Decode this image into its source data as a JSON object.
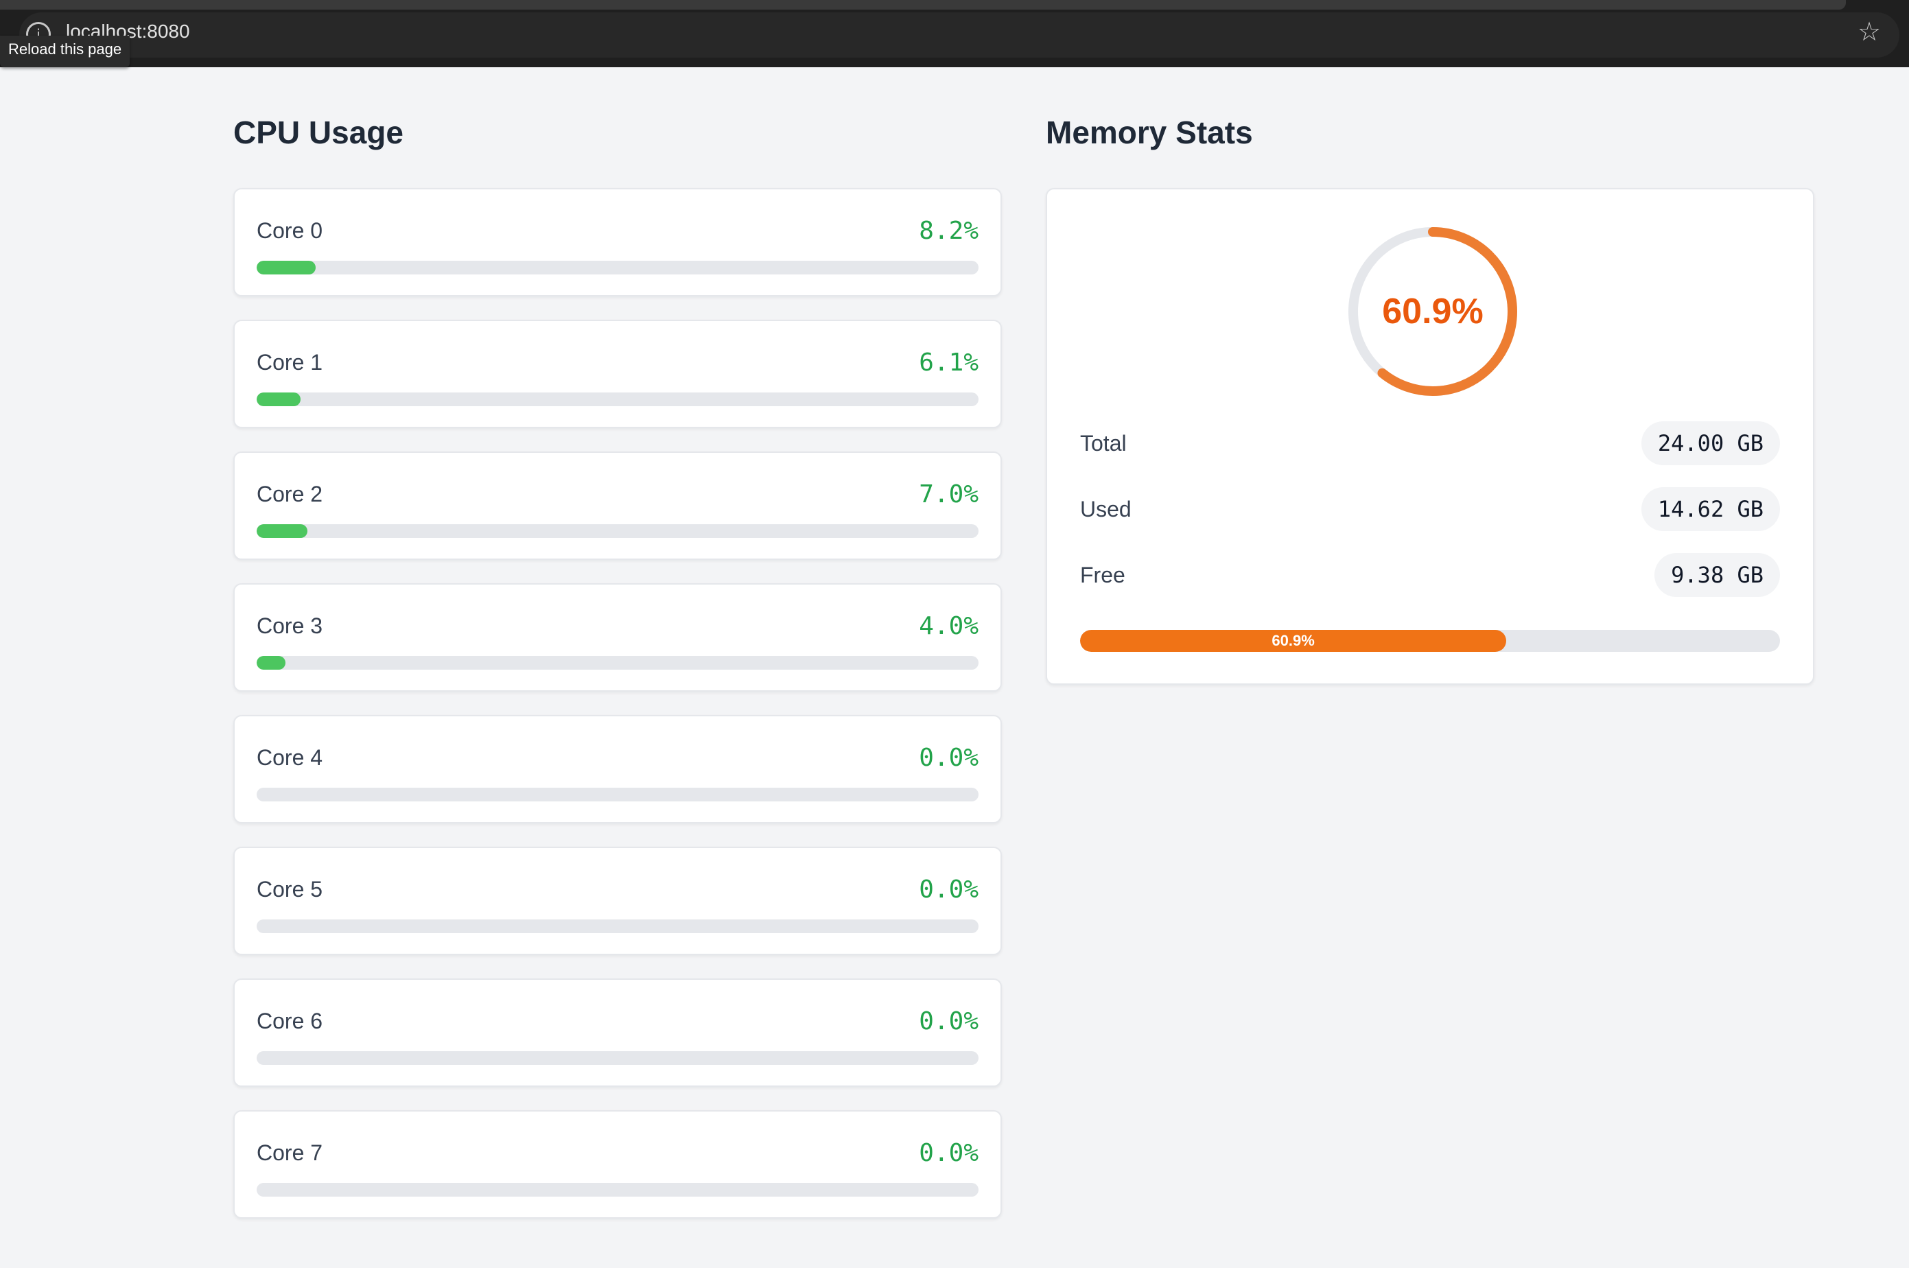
{
  "browser": {
    "url": "localhost:8080",
    "tooltip": "Reload this page",
    "info_icon": "info-icon",
    "star_icon": "bookmark-star-icon"
  },
  "cpu": {
    "title": "CPU Usage",
    "cores": [
      {
        "label": "Core 0",
        "value_text": "8.2%",
        "percent": 8.2
      },
      {
        "label": "Core 1",
        "value_text": "6.1%",
        "percent": 6.1
      },
      {
        "label": "Core 2",
        "value_text": "7.0%",
        "percent": 7.0
      },
      {
        "label": "Core 3",
        "value_text": "4.0%",
        "percent": 4.0
      },
      {
        "label": "Core 4",
        "value_text": "0.0%",
        "percent": 0.0
      },
      {
        "label": "Core 5",
        "value_text": "0.0%",
        "percent": 0.0
      },
      {
        "label": "Core 6",
        "value_text": "0.0%",
        "percent": 0.0
      },
      {
        "label": "Core 7",
        "value_text": "0.0%",
        "percent": 0.0
      }
    ]
  },
  "memory": {
    "title": "Memory Stats",
    "gauge_text": "60.9%",
    "percent": 60.9,
    "stats": {
      "total_label": "Total",
      "total_value": "24.00 GB",
      "used_label": "Used",
      "used_value": "14.62 GB",
      "free_label": "Free",
      "free_value": "9.38 GB"
    },
    "bar_text": "60.9%"
  },
  "colors": {
    "cpu_accent": "#22a34a",
    "cpu_bar": "#4cc65f",
    "memory_accent": "#ea580c",
    "memory_bar": "#f07316",
    "track": "#e5e7eb"
  }
}
